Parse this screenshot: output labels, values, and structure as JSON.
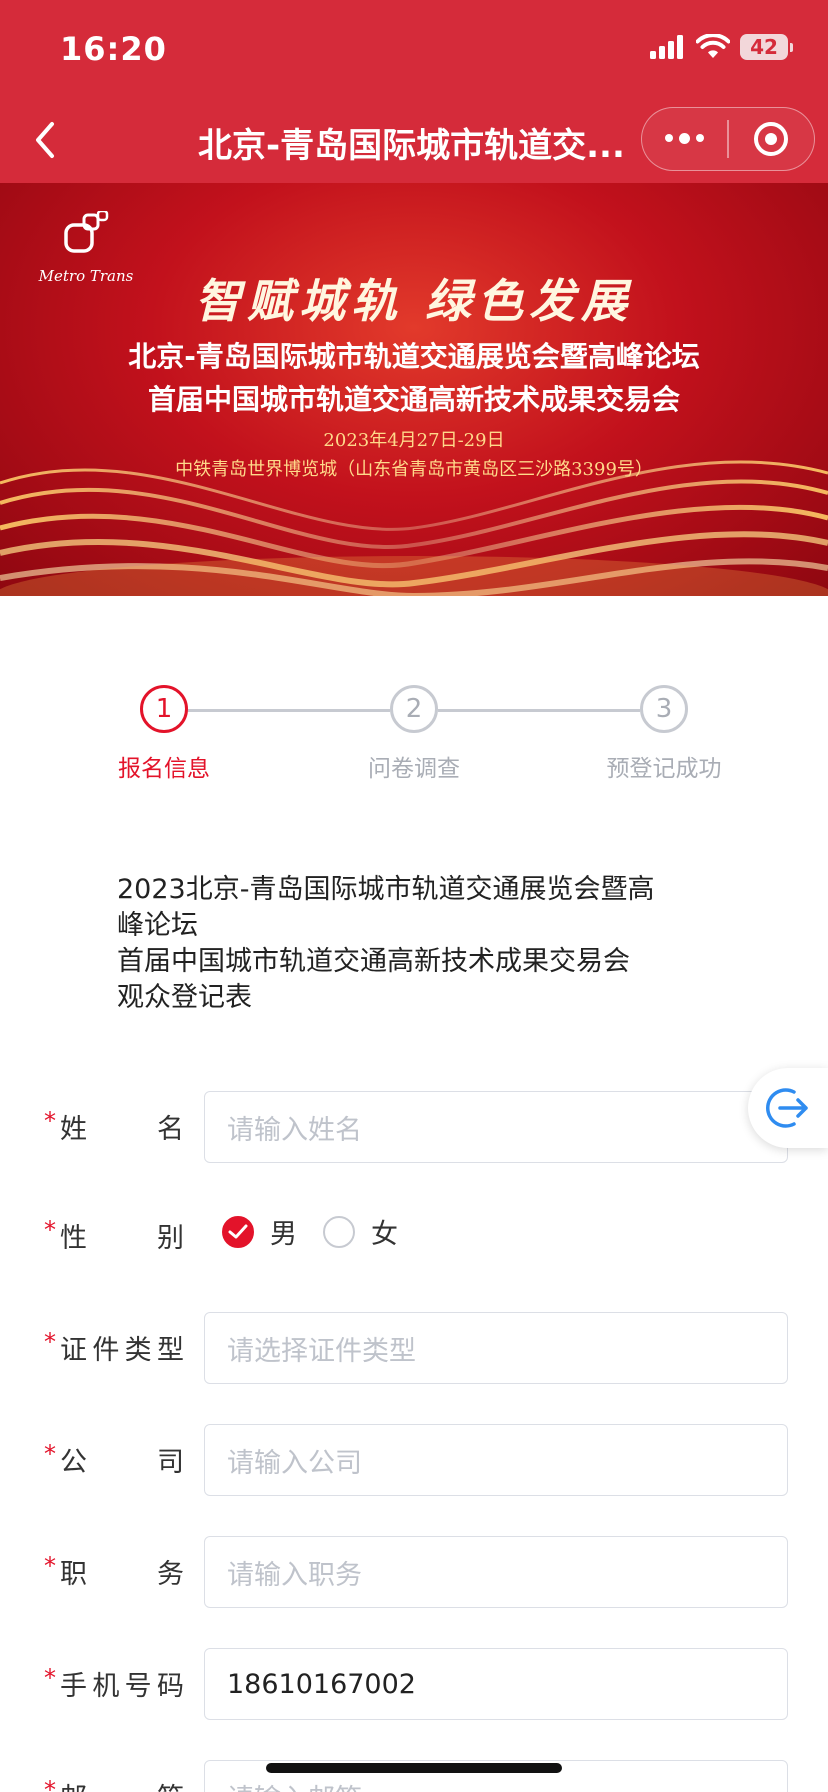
{
  "status_bar": {
    "time": "16:20",
    "battery": "42"
  },
  "nav": {
    "title": "北京-青岛国际城市轨道交..."
  },
  "banner": {
    "logo_text": "Metro Trans",
    "slogan": "智赋城轨 绿色发展",
    "line1": "北京-青岛国际城市轨道交通展览会暨高峰论坛",
    "line2": "首届中国城市轨道交通高新技术成果交易会",
    "date": "2023年4月27日-29日",
    "venue": "中铁青岛世界博览城（山东省青岛市黄岛区三沙路3399号）"
  },
  "steps": [
    {
      "num": "1",
      "label": "报名信息",
      "active": true
    },
    {
      "num": "2",
      "label": "问卷调查",
      "active": false
    },
    {
      "num": "3",
      "label": "预登记成功",
      "active": false
    }
  ],
  "form_title": {
    "line1": "2023北京-青岛国际城市轨道交通展览会暨高\n峰论坛",
    "line2": "首届中国城市轨道交通高新技术成果交易会",
    "line3": "观众登记表"
  },
  "form": {
    "required_mark": "*",
    "name": {
      "label": "姓名",
      "placeholder": "请输入姓名"
    },
    "gender": {
      "label": "性别",
      "options": [
        "男",
        "女"
      ],
      "selected": "男"
    },
    "id_type": {
      "label": "证件类型",
      "placeholder": "请选择证件类型"
    },
    "company": {
      "label": "公司",
      "placeholder": "请输入公司"
    },
    "position": {
      "label": "职务",
      "placeholder": "请输入职务"
    },
    "phone": {
      "label": "手机号码",
      "value": "18610167002"
    },
    "email": {
      "label": "邮箱",
      "placeholder": "请输入邮箱"
    }
  },
  "colors": {
    "brand_red": "#d52b3a",
    "accent_red": "#e3132a",
    "muted": "#a9adb5"
  }
}
